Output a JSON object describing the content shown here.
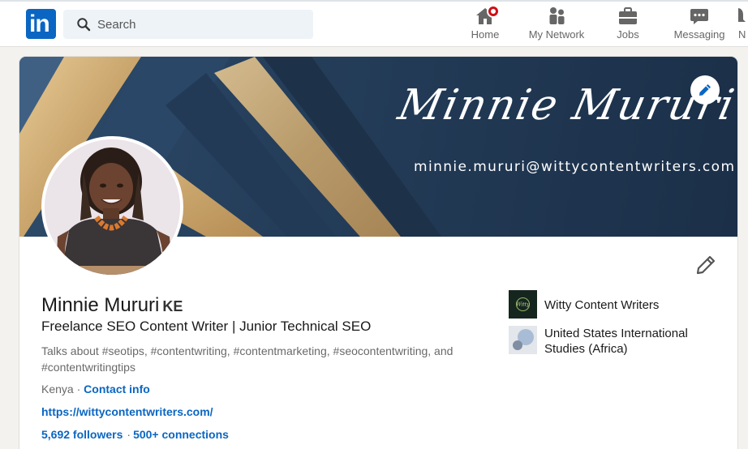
{
  "nav": {
    "logo_text": "in",
    "search_placeholder": "Search",
    "items": [
      {
        "label": "Home",
        "icon": "home-icon"
      },
      {
        "label": "My Network",
        "icon": "network-icon"
      },
      {
        "label": "Jobs",
        "icon": "briefcase-icon"
      },
      {
        "label": "Messaging",
        "icon": "messaging-icon"
      },
      {
        "label": "N",
        "icon": "notifications-icon"
      }
    ]
  },
  "banner": {
    "signature": "Minnie Mururi",
    "email": "minnie.mururi@wittycontentwriters.com"
  },
  "profile": {
    "name": "Minnie Mururi",
    "pronoun_badge": "KE",
    "headline": "Freelance SEO Content Writer | Junior Technical SEO",
    "about": "Talks about #seotips, #contentwriting, #contentmarketing, #seocontentwriting, and #contentwritingtips",
    "location": "Kenya",
    "location_sep": "·",
    "contact_info": "Contact info",
    "website": "https://wittycontentwriters.com/",
    "followers": "5,692 followers",
    "connections_sep": "·",
    "connections": "500+ connections"
  },
  "organizations": [
    {
      "name": "Witty Content Writers",
      "logo_text": "Witty"
    },
    {
      "name": "United States International Studies (Africa)"
    }
  ],
  "colors": {
    "brand_blue": "#0a66c2",
    "notification_red": "#cc1016",
    "banner_navy": "#243d59",
    "banner_gold": "#c9a56c"
  }
}
